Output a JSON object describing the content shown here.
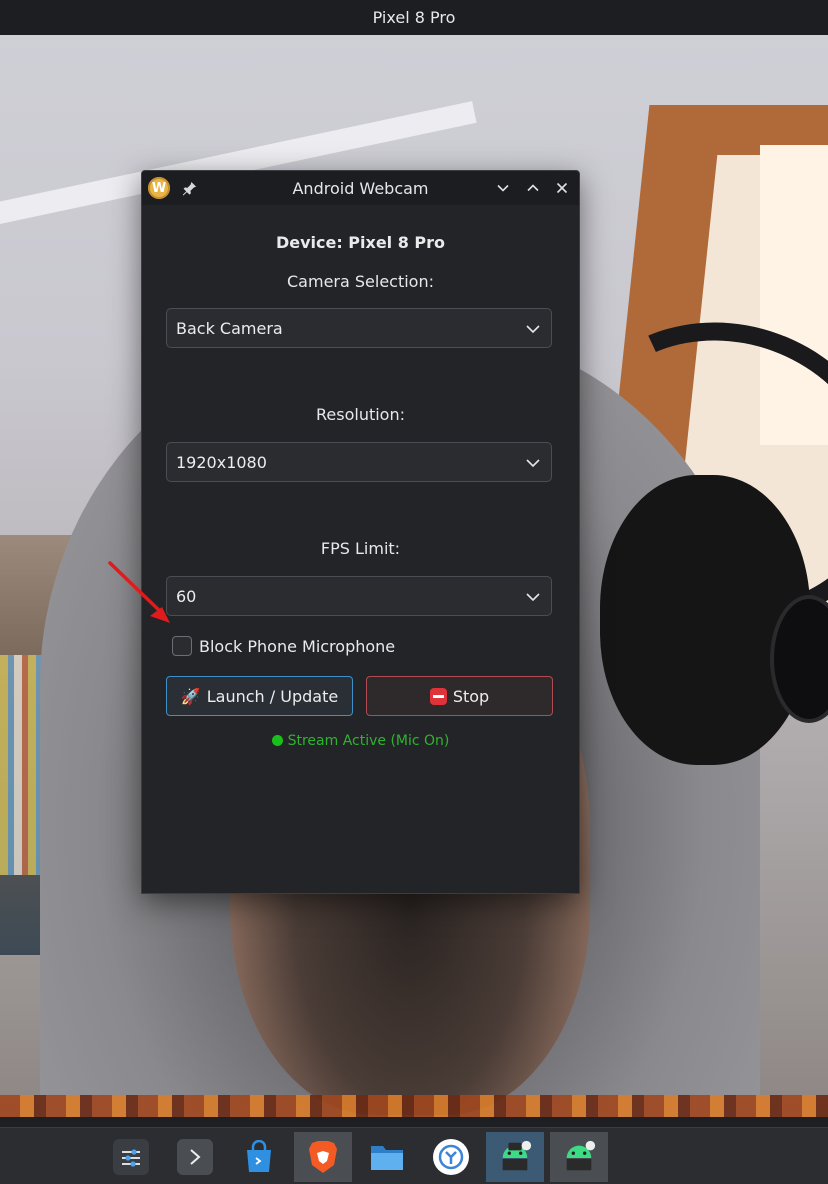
{
  "phone": {
    "title": "Pixel 8 Pro"
  },
  "window": {
    "title": "Android Webcam",
    "app_icon_letter": "W",
    "pin_icon": "pin-icon",
    "controls": [
      "minimize",
      "maximize",
      "close"
    ]
  },
  "form": {
    "device_label": "Device: Pixel 8 Pro",
    "camera_label": "Camera Selection:",
    "camera_value": "Back Camera",
    "resolution_label": "Resolution:",
    "resolution_value": "1920x1080",
    "fps_label": "FPS Limit:",
    "fps_value": "60",
    "block_mic_label": "Block Phone Microphone",
    "block_mic_checked": false,
    "launch_button": "Launch / Update",
    "launch_icon": "🚀",
    "stop_button": "Stop",
    "status_text": "Stream Active (Mic On)"
  },
  "colors": {
    "accent": "#3f8fc9",
    "stop_border": "#b24a54",
    "status_green": "#2fb32f",
    "annotation_red": "#e01b1b"
  },
  "taskbar": {
    "items": [
      {
        "icon": "settings-sliders-icon"
      },
      {
        "icon": "terminal-icon"
      },
      {
        "icon": "store-bag-icon"
      },
      {
        "icon": "brave-browser-icon"
      },
      {
        "icon": "file-manager-icon"
      },
      {
        "icon": "kde-connect-icon"
      },
      {
        "icon": "android-webcam-icon"
      },
      {
        "icon": "android-webcam-icon"
      }
    ]
  }
}
